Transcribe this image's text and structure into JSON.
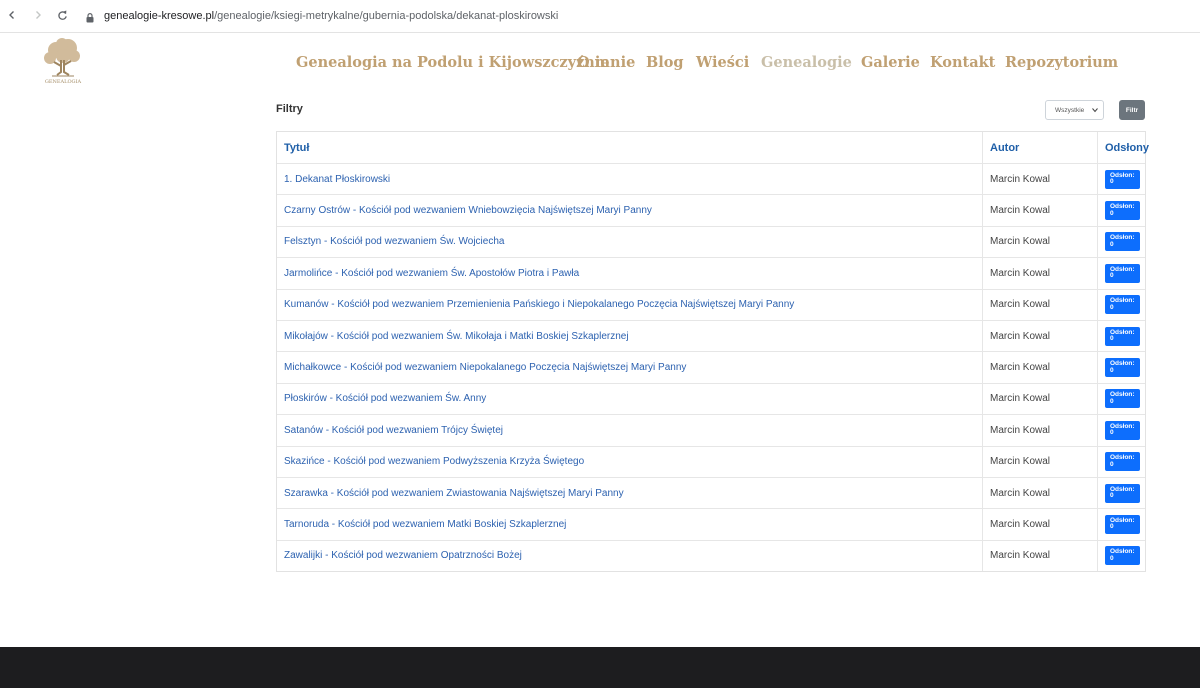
{
  "browser": {
    "url_host": "genealogie-kresowe.pl",
    "url_path": "/genealogie/ksiegi-metrykalne/gubernia-podolska/dekanat-ploskirowski"
  },
  "logo": {
    "text": "GENEALOGIA"
  },
  "nav": [
    {
      "label": "Genealogia na Podolu i Kijowszczyźnie"
    },
    {
      "label": "O mnie"
    },
    {
      "label": "Blog"
    },
    {
      "label": "Wieści"
    },
    {
      "label": "Genealogie",
      "active": true
    },
    {
      "label": "Galerie"
    },
    {
      "label": "Kontakt"
    },
    {
      "label": "Repozytorium"
    }
  ],
  "filters": {
    "label": "Filtry",
    "select_value": "Wszystkie",
    "button_label": "Filtr"
  },
  "table": {
    "headers": {
      "title": "Tytuł",
      "author": "Autor",
      "views": "Odsłony"
    },
    "rows": [
      {
        "title": "1. Dekanat Płoskirowski",
        "author": "Marcin Kowal",
        "views": "Odsłon: 0"
      },
      {
        "title": "Czarny Ostrów - Kościół pod wezwaniem Wniebowzięcia Najświętszej Maryi Panny",
        "author": "Marcin Kowal",
        "views": "Odsłon: 0"
      },
      {
        "title": "Felsztyn - Kościół pod wezwaniem Św. Wojciecha",
        "author": "Marcin Kowal",
        "views": "Odsłon: 0"
      },
      {
        "title": "Jarmolińce - Kościół pod wezwaniem Św. Apostołów Piotra i Pawła",
        "author": "Marcin Kowal",
        "views": "Odsłon: 0"
      },
      {
        "title": "Kumanów - Kościół pod wezwaniem Przemienienia Pańskiego i Niepokalanego Poczęcia Najświętszej Maryi Panny",
        "author": "Marcin Kowal",
        "views": "Odsłon: 0"
      },
      {
        "title": "Mikołajów - Kościół pod wezwaniem Św. Mikołaja i Matki Boskiej Szkaplerznej",
        "author": "Marcin Kowal",
        "views": "Odsłon: 0"
      },
      {
        "title": "Michałkowce - Kościół pod wezwaniem Niepokalanego Poczęcia Najświętszej Maryi Panny",
        "author": "Marcin Kowal",
        "views": "Odsłon: 0"
      },
      {
        "title": "Płoskirów - Kościół pod wezwaniem Św. Anny",
        "author": "Marcin Kowal",
        "views": "Odsłon: 0"
      },
      {
        "title": "Satanów - Kościół pod wezwaniem Trójcy Świętej",
        "author": "Marcin Kowal",
        "views": "Odsłon: 0"
      },
      {
        "title": "Skazińce - Kościół pod wezwaniem Podwyższenia Krzyża Świętego",
        "author": "Marcin Kowal",
        "views": "Odsłon: 0"
      },
      {
        "title": "Szarawka - Kościół pod wezwaniem Zwiastowania Najświętszej Maryi Panny",
        "author": "Marcin Kowal",
        "views": "Odsłon: 0"
      },
      {
        "title": "Tarnoruda - Kościół pod wezwaniem Matki Boskiej Szkaplerznej",
        "author": "Marcin Kowal",
        "views": "Odsłon: 0"
      },
      {
        "title": "Zawalijki - Kościół pod wezwaniem Opatrzności Bożej",
        "author": "Marcin Kowal",
        "views": "Odsłon: 0"
      }
    ]
  },
  "colors": {
    "nav": "#c0a072",
    "nav_active": "#c9bfa9",
    "link": "#2d62b0",
    "header": "#1f5fa8",
    "badge": "#0d6efd",
    "filter_button": "#6c757d",
    "footer": "#1d1d1f"
  },
  "icons": [
    "back-arrow-icon",
    "forward-arrow-icon",
    "reload-icon",
    "lock-icon",
    "tree-logo-icon",
    "chevron-down-icon"
  ]
}
